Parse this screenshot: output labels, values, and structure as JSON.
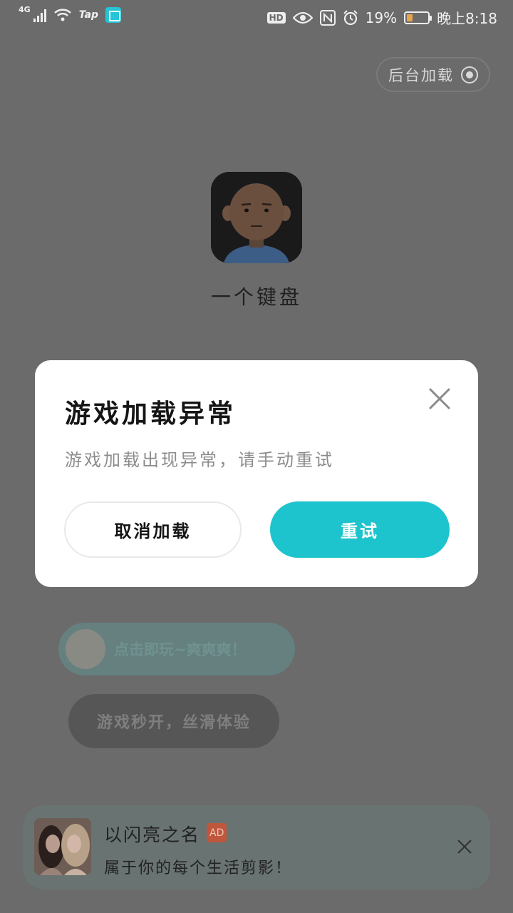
{
  "status_bar": {
    "signal_label": "4G",
    "carrier_app": "Tap",
    "hd_label": "HD",
    "battery": "19%",
    "time": "晚上8:18",
    "battery_color": "#e8a64a"
  },
  "background": {
    "bg_load_label": "后台加载",
    "game_name": "一个键盘",
    "promo_text": "点击即玩~爽爽爽！",
    "speed_text": "游戏秒开，丝滑体验"
  },
  "ad": {
    "title": "以闪亮之名",
    "badge": "AD",
    "subtitle": "属于你的每个生活剪影！"
  },
  "dialog": {
    "title": "游戏加载异常",
    "message": "游戏加载出现异常，请手动重试",
    "cancel_label": "取消加载",
    "retry_label": "重试",
    "accent_color": "#1dc4cd"
  }
}
